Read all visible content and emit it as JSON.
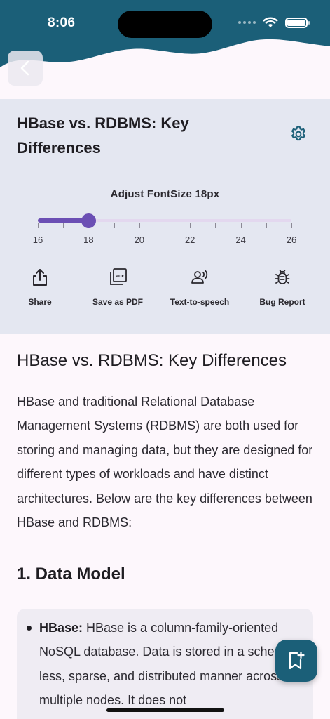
{
  "status_bar": {
    "time": "8:06"
  },
  "colors": {
    "header": "#1b5f78",
    "panel": "#e4e7f1",
    "accent": "#6b4fb4",
    "fab": "#1b5f78",
    "icon_teal": "#1b5f78"
  },
  "header": {
    "back_icon": "chevron-left-icon"
  },
  "panel": {
    "title": "HBase vs. RDBMS: Key Differences",
    "settings_icon": "gear-icon",
    "font_size_label": "Adjust FontSize 18px",
    "slider": {
      "min": 16,
      "max": 26,
      "value": 18,
      "tick_labels": [
        "16",
        "18",
        "20",
        "22",
        "24",
        "26"
      ]
    },
    "actions": [
      {
        "icon": "share-icon",
        "label": "Share"
      },
      {
        "icon": "pdf-icon",
        "label": "Save as PDF"
      },
      {
        "icon": "speaker-icon",
        "label": "Text-to-speech"
      },
      {
        "icon": "bug-icon",
        "label": "Bug Report"
      }
    ]
  },
  "article": {
    "title": "HBase vs. RDBMS: Key Differences",
    "intro": "HBase and traditional Relational Database Management Systems (RDBMS) are both used for storing and managing data, but they are designed for different types of workloads and have distinct architectures. Below are the key differences between HBase and RDBMS:",
    "section_1_title": "1. Data Model",
    "section_1_items": [
      {
        "term": "HBase:",
        "text": " HBase is a column-family-oriented NoSQL database. Data is stored in a schema-less, sparse, and distributed manner across multiple nodes. It does not"
      }
    ]
  },
  "fab": {
    "icon": "bookmark-add-icon"
  }
}
